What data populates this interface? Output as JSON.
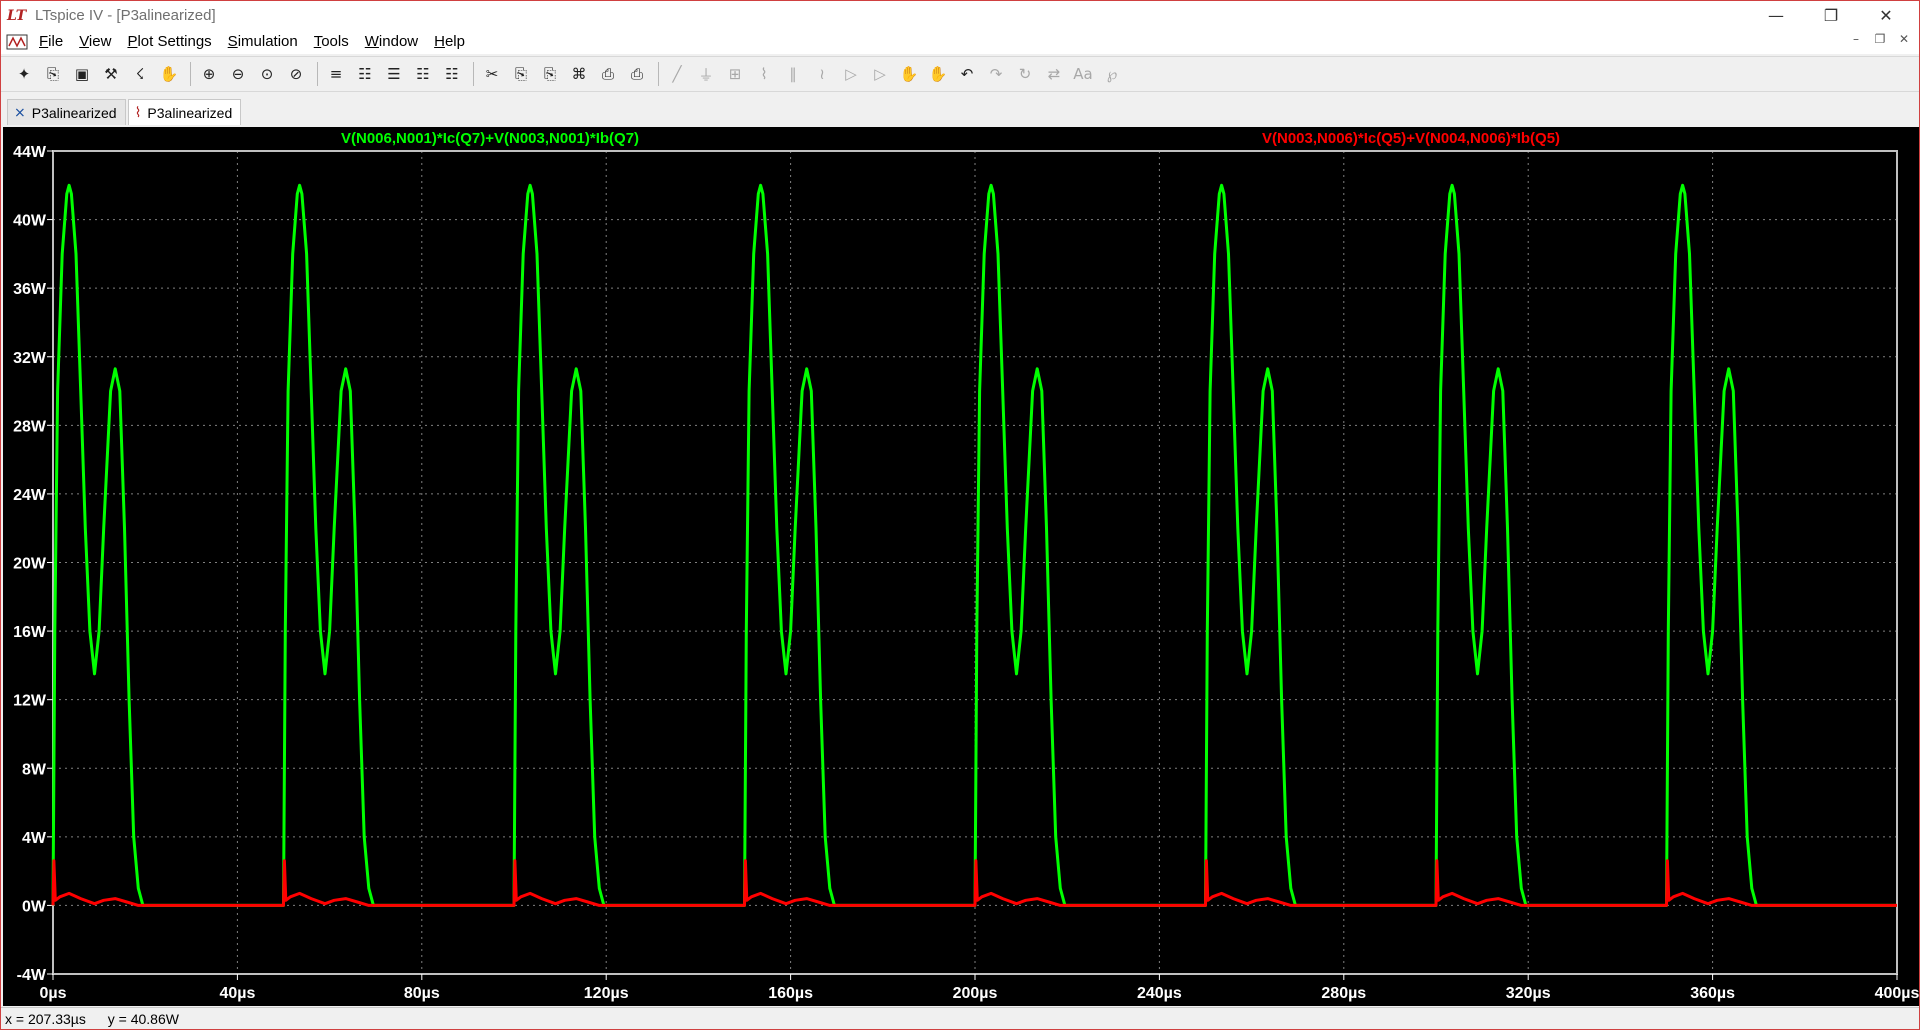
{
  "window": {
    "title": "LTspice IV - [P3alinearized]",
    "logo_text": "LT",
    "controls": {
      "minimize": "—",
      "maximize": "❐",
      "close": "✕"
    }
  },
  "menu": {
    "items": [
      {
        "underline": "F",
        "rest": "ile"
      },
      {
        "underline": "V",
        "rest": "iew"
      },
      {
        "underline": "P",
        "rest": "lot Settings"
      },
      {
        "underline": "S",
        "rest": "imulation"
      },
      {
        "underline": "T",
        "rest": "ools"
      },
      {
        "underline": "W",
        "rest": "indow"
      },
      {
        "underline": "H",
        "rest": "elp"
      }
    ],
    "mdi_controls": {
      "minimize": "–",
      "restore": "❐",
      "close": "✕"
    }
  },
  "toolbar": {
    "icons": [
      "new-schematic-icon",
      "open-icon",
      "save-icon",
      "control-panel-icon",
      "run-icon",
      "halt-icon",
      "zoom-in-icon",
      "zoom-out-icon",
      "zoom-extents-icon",
      "zoom-cancel-icon",
      "autorange-icon",
      "mark-unsorted-icon",
      "tile-horizontal-icon",
      "cascade-icon",
      "tile-vertical-icon",
      "cut-icon",
      "copy-icon",
      "paste-icon",
      "find-icon",
      "print-preview-icon",
      "print-icon",
      "wire-icon",
      "ground-icon",
      "label-net-icon",
      "resistor-icon",
      "capacitor-icon",
      "inductor-icon",
      "diode-icon",
      "component-icon",
      "move-icon",
      "drag-icon",
      "undo-icon",
      "redo-icon",
      "rotate-icon",
      "mirror-icon",
      "text-icon",
      "spice-directive-icon"
    ],
    "glyphs": [
      "✦",
      "⎘",
      "▣",
      "⚒",
      "☇",
      "✋",
      "⊕",
      "⊖",
      "⊙",
      "⊘",
      "≡",
      "☷",
      "☰",
      "☷",
      "☷",
      "✂",
      "⎘",
      "⎘",
      "⌘",
      "⎙",
      "⎙",
      "╱",
      "⏚",
      "⊞",
      "⌇",
      "∥",
      "≀",
      "▷",
      "▷",
      "✋",
      "✋",
      "↶",
      "↷",
      "↻",
      "⇄",
      "Aa",
      "℘"
    ]
  },
  "tabs": [
    {
      "label": "P3alinearized",
      "icon": "schematic-icon",
      "glyph": "⨯",
      "active": false
    },
    {
      "label": "P3alinearized",
      "icon": "waveform-icon",
      "glyph": "⌇",
      "active": true
    }
  ],
  "plot": {
    "background": "#000000",
    "grid_color": "#808080",
    "axis_color": "#ffffff",
    "traces": [
      {
        "name": "V(N006,N001)*Ic(Q7)+V(N003,N001)*Ib(Q7)",
        "color": "#00ff00"
      },
      {
        "name": "V(N003,N006)*Ic(Q5)+V(N004,N006)*Ib(Q5)",
        "color": "#ff0000"
      }
    ]
  },
  "chart_data": {
    "type": "line",
    "title": "",
    "xlabel": "",
    "ylabel": "",
    "xlim": [
      0,
      400
    ],
    "ylim": [
      -4,
      44
    ],
    "x_unit": "µs",
    "y_unit": "W",
    "grid": true,
    "xticks": [
      "0µs",
      "40µs",
      "80µs",
      "120µs",
      "160µs",
      "200µs",
      "240µs",
      "280µs",
      "320µs",
      "360µs",
      "400µs"
    ],
    "yticks": [
      "-4W",
      "0W",
      "4W",
      "8W",
      "12W",
      "16W",
      "20W",
      "24W",
      "28W",
      "32W",
      "36W",
      "40W",
      "44W"
    ],
    "period": 50,
    "series": [
      {
        "name": "V(N006,N001)*Ic(Q7)+V(N003,N001)*Ib(Q7)",
        "color": "#00ff00",
        "cycle_points": [
          [
            0,
            0
          ],
          [
            0.4,
            16
          ],
          [
            1.0,
            30
          ],
          [
            2.0,
            38
          ],
          [
            3.0,
            41.5
          ],
          [
            3.5,
            42
          ],
          [
            4.0,
            41.5
          ],
          [
            5.0,
            38
          ],
          [
            6.0,
            30
          ],
          [
            7.0,
            22
          ],
          [
            8.0,
            16
          ],
          [
            9.0,
            13.5
          ],
          [
            10.0,
            16
          ],
          [
            11.0,
            22
          ],
          [
            12.5,
            30
          ],
          [
            13.5,
            31.3
          ],
          [
            14.5,
            30
          ],
          [
            15.5,
            22
          ],
          [
            16.5,
            12
          ],
          [
            17.5,
            4
          ],
          [
            18.5,
            1
          ],
          [
            19.5,
            0
          ],
          [
            50,
            0
          ]
        ]
      },
      {
        "name": "V(N003,N006)*Ic(Q5)+V(N004,N006)*Ib(Q5)",
        "color": "#ff0000",
        "cycle_points": [
          [
            0,
            0
          ],
          [
            0.2,
            2.6
          ],
          [
            0.5,
            0.3
          ],
          [
            1.5,
            0.5
          ],
          [
            3.5,
            0.7
          ],
          [
            6.0,
            0.4
          ],
          [
            9.0,
            0.1
          ],
          [
            11.0,
            0.3
          ],
          [
            13.5,
            0.4
          ],
          [
            16.0,
            0.2
          ],
          [
            18.5,
            0
          ],
          [
            50,
            0
          ]
        ]
      }
    ]
  },
  "status": {
    "x": "x = 207.33µs",
    "y": "y = 40.86W"
  }
}
